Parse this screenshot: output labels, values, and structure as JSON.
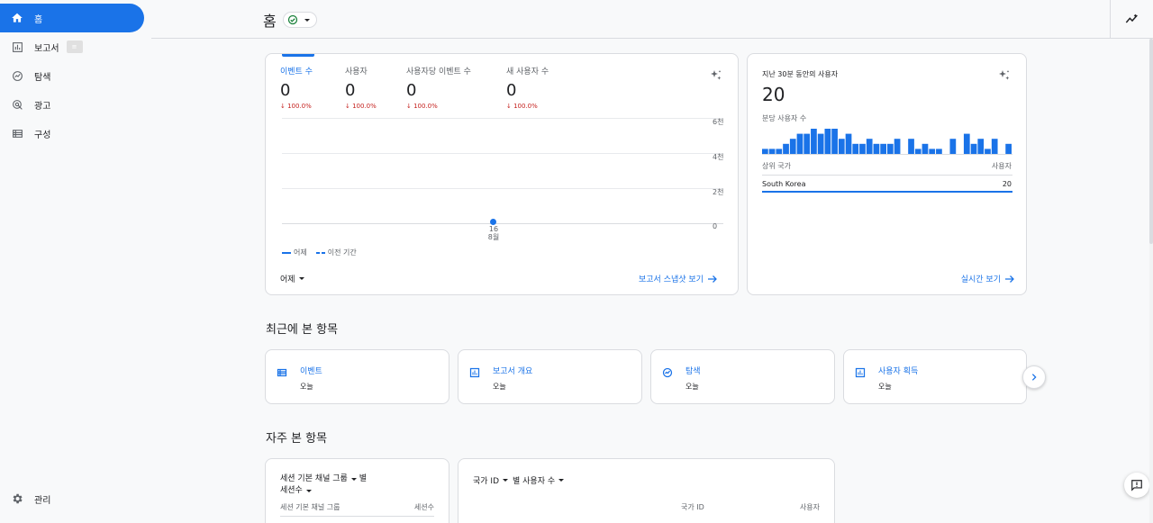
{
  "sidebar": {
    "items": [
      {
        "label": "홈",
        "icon": "home-icon"
      },
      {
        "label": "보고서",
        "icon": "bar-chart-icon",
        "badge": "≡"
      },
      {
        "label": "탐색",
        "icon": "explore-icon"
      },
      {
        "label": "광고",
        "icon": "ads-icon"
      },
      {
        "label": "구성",
        "icon": "list-icon"
      }
    ],
    "admin": {
      "label": "관리",
      "icon": "gear-icon"
    }
  },
  "header": {
    "title": "홈"
  },
  "overview": {
    "metrics": [
      {
        "label": "이벤트 수",
        "value": "0",
        "change": "100.0%"
      },
      {
        "label": "사용자",
        "value": "0",
        "change": "100.0%"
      },
      {
        "label": "사용자당 이벤트 수",
        "value": "0",
        "change": "100.0%"
      },
      {
        "label": "새 사용자 수",
        "value": "0",
        "change": "100.0%"
      }
    ],
    "y_ticks": [
      "6천",
      "4천",
      "2천",
      "0"
    ],
    "x_label_day": "16",
    "x_label_month": "8월",
    "legend_current": "어제",
    "legend_previous": "이전 기간",
    "date_range": "어제",
    "snapshot_link": "보고서 스냅샷 보기"
  },
  "realtime": {
    "title": "지난 30분 동안의 사용자",
    "value": "20",
    "subtitle": "분당 사용자 수",
    "table_header_left": "상위 국가",
    "table_header_right": "사용자",
    "row_country": "South Korea",
    "row_value": "20",
    "link": "실시간 보기"
  },
  "chart_data": {
    "type": "bar",
    "title": "분당 사용자 수",
    "values": [
      1,
      1,
      1,
      2,
      3,
      4,
      4,
      5,
      4,
      5,
      5,
      3,
      4,
      2,
      2,
      3,
      2,
      2,
      2,
      3,
      0,
      3,
      1,
      2,
      1,
      1,
      0,
      3,
      0,
      4,
      2,
      3,
      1,
      3,
      0,
      2
    ]
  },
  "recent": {
    "title": "최근에 본 항목",
    "items": [
      {
        "title": "이벤트",
        "sub": "오늘",
        "icon": "list-icon"
      },
      {
        "title": "보고서 개요",
        "sub": "오늘",
        "icon": "bar-chart-icon"
      },
      {
        "title": "탐색",
        "sub": "오늘",
        "icon": "explore-icon"
      },
      {
        "title": "사용자 획득",
        "sub": "오늘",
        "icon": "bar-chart-icon"
      }
    ]
  },
  "frequent": {
    "title": "자주 본 항목",
    "card1": {
      "dim": "세션 기본 채널 그룹",
      "by": "별",
      "metric": "세션수",
      "col_left": "세션 기본 채널 그룹",
      "col_right": "세션수"
    },
    "card2": {
      "dim": "국가 ID",
      "by": "별 사용자 수",
      "col_left": "국가 ID",
      "col_right": "사용자"
    }
  },
  "colors": {
    "accent": "#1a73e8",
    "negative": "#c5221f"
  }
}
